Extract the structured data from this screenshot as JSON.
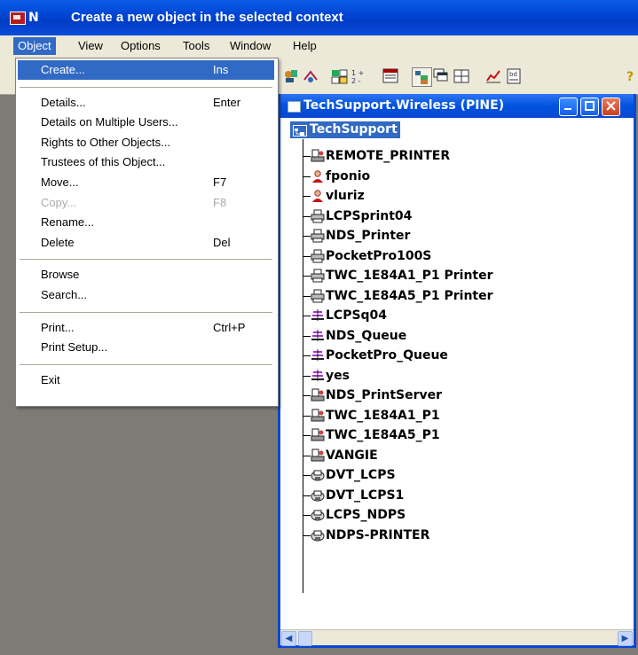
{
  "window": {
    "title_short": "N",
    "title": "Create a new object in the selected context"
  },
  "menubar": [
    {
      "label": "Object",
      "active": true
    },
    {
      "label": "View"
    },
    {
      "label": "Options"
    },
    {
      "label": "Tools"
    },
    {
      "label": "Window"
    },
    {
      "label": "Help"
    }
  ],
  "object_menu": [
    {
      "label": "Create...",
      "shortcut": "Ins",
      "highlighted": true
    },
    {
      "separator": true
    },
    {
      "label": "Details...",
      "shortcut": "Enter"
    },
    {
      "label": "Details on Multiple Users..."
    },
    {
      "label": "Rights to Other Objects..."
    },
    {
      "label": "Trustees of this Object..."
    },
    {
      "label": "Move...",
      "shortcut": "F7"
    },
    {
      "label": "Copy...",
      "shortcut": "F8",
      "disabled": true
    },
    {
      "label": "Rename..."
    },
    {
      "label": "Delete",
      "shortcut": "Del"
    },
    {
      "separator": true
    },
    {
      "label": "Browse"
    },
    {
      "label": "Search..."
    },
    {
      "separator": true
    },
    {
      "label": "Print...",
      "shortcut": "Ctrl+P"
    },
    {
      "label": "Print Setup..."
    },
    {
      "separator": true
    },
    {
      "label": "Exit"
    }
  ],
  "browser": {
    "title": "TechSupport.Wireless (PINE)",
    "root": "TechSupport",
    "items": [
      {
        "label": "REMOTE_PRINTER",
        "icon": "print-server-icon"
      },
      {
        "label": "fponio",
        "icon": "user-icon"
      },
      {
        "label": "vluriz",
        "icon": "user-icon"
      },
      {
        "label": "LCPSprint04",
        "icon": "printer-icon"
      },
      {
        "label": "NDS_Printer",
        "icon": "printer-icon"
      },
      {
        "label": "PocketPro100S",
        "icon": "printer-icon"
      },
      {
        "label": "TWC_1E84A1_P1 Printer",
        "icon": "printer-icon"
      },
      {
        "label": "TWC_1E84A5_P1 Printer",
        "icon": "printer-icon"
      },
      {
        "label": "LCPSq04",
        "icon": "print-queue-icon"
      },
      {
        "label": "NDS_Queue",
        "icon": "print-queue-icon"
      },
      {
        "label": "PocketPro_Queue",
        "icon": "print-queue-icon"
      },
      {
        "label": "yes",
        "icon": "print-queue-icon"
      },
      {
        "label": "NDS_PrintServer",
        "icon": "print-server-icon"
      },
      {
        "label": "TWC_1E84A1_P1",
        "icon": "print-server-icon"
      },
      {
        "label": "TWC_1E84A5_P1",
        "icon": "print-server-icon"
      },
      {
        "label": "VANGIE",
        "icon": "print-server-icon"
      },
      {
        "label": "DVT_LCPS",
        "icon": "ndps-manager-icon"
      },
      {
        "label": "DVT_LCPS1",
        "icon": "ndps-manager-icon"
      },
      {
        "label": "LCPS_NDPS",
        "icon": "ndps-manager-icon"
      },
      {
        "label": "NDPS-PRINTER",
        "icon": "ndps-manager-icon"
      }
    ]
  },
  "colors": {
    "highlight": "#316ac5",
    "titlebar": "#0046d5",
    "menu_bg": "#ece9d8"
  }
}
